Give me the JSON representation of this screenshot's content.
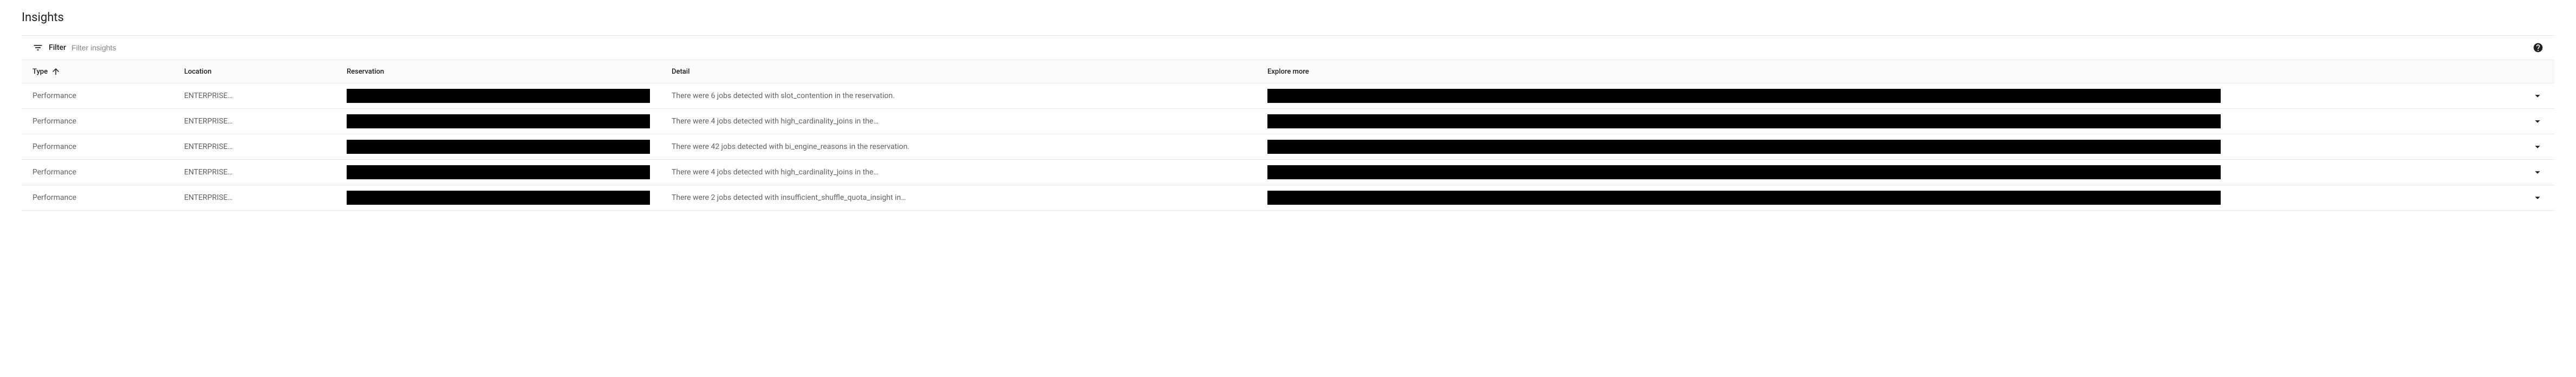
{
  "page": {
    "title": "Insights"
  },
  "filter": {
    "label": "Filter",
    "placeholder": "Filter insights"
  },
  "table": {
    "headers": {
      "type": "Type",
      "location": "Location",
      "reservation": "Reservation",
      "detail": "Detail",
      "explore": "Explore more"
    },
    "sort": {
      "column": "type",
      "direction": "asc"
    },
    "rows": [
      {
        "type": "Performance",
        "location": "ENTERPRISE…",
        "reservation": "[redacted]",
        "detail": "There were 6 jobs detected with slot_contention in the reservation.",
        "explore": "[redacted]"
      },
      {
        "type": "Performance",
        "location": "ENTERPRISE…",
        "reservation": "[redacted]",
        "detail": "There were 4 jobs detected with high_cardinality_joins in the…",
        "explore": "[redacted]"
      },
      {
        "type": "Performance",
        "location": "ENTERPRISE…",
        "reservation": "[redacted]",
        "detail": "There were 42 jobs detected with bi_engine_reasons in the reservation.",
        "explore": "[redacted]"
      },
      {
        "type": "Performance",
        "location": "ENTERPRISE…",
        "reservation": "[redacted]",
        "detail": "There were 4 jobs detected with high_cardinality_joins in the…",
        "explore": "[redacted]"
      },
      {
        "type": "Performance",
        "location": "ENTERPRISE…",
        "reservation": "[redacted]",
        "detail": "There were 2 jobs detected with insufficient_shuffle_quota_insight in…",
        "explore": "[redacted]"
      }
    ]
  }
}
